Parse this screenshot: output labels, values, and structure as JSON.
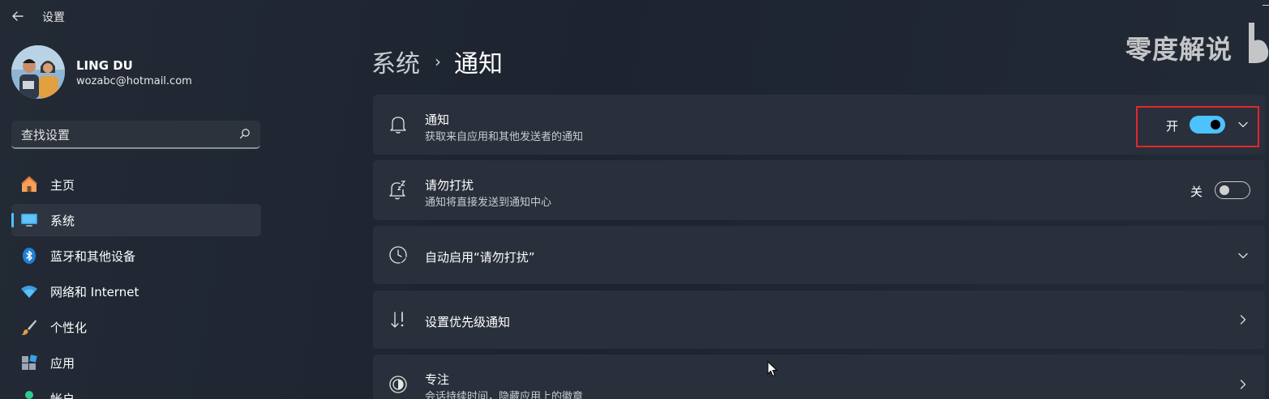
{
  "titlebar": {
    "back_icon": "back-arrow-icon",
    "title": "设置"
  },
  "profile": {
    "name": "LING DU",
    "email": "wozabc@hotmail.com"
  },
  "search": {
    "placeholder": "查找设置",
    "icon": "search-icon"
  },
  "nav": {
    "items": [
      {
        "label": "主页",
        "icon": "home-icon",
        "active": false
      },
      {
        "label": "系统",
        "icon": "system-monitor-icon",
        "active": true
      },
      {
        "label": "蓝牙和其他设备",
        "icon": "bluetooth-icon",
        "active": false
      },
      {
        "label": "网络和 Internet",
        "icon": "wifi-icon",
        "active": false
      },
      {
        "label": "个性化",
        "icon": "paintbrush-icon",
        "active": false
      },
      {
        "label": "应用",
        "icon": "apps-icon",
        "active": false
      },
      {
        "label": "帐户",
        "icon": "account-icon",
        "active": false
      }
    ]
  },
  "header": {
    "breadcrumb_parent": "系统",
    "breadcrumb_sep": "›",
    "breadcrumb_current": "通知"
  },
  "watermark": "零度解说",
  "settings": {
    "notifications": {
      "title": "通知",
      "subtitle": "获取来自应用和其他发送者的通知",
      "state_label": "开",
      "enabled": true,
      "icon": "bell-icon"
    },
    "dnd": {
      "title": "请勿打扰",
      "subtitle": "通知将直接发送到通知中心",
      "state_label": "关",
      "enabled": false,
      "icon": "bell-snooze-icon"
    },
    "auto_dnd": {
      "title": "自动启用“请勿打扰”",
      "icon": "clock-icon"
    },
    "priority": {
      "title": "设置优先级通知",
      "icon": "priority-sort-icon"
    },
    "focus": {
      "title": "专注",
      "subtitle": "会话持续时间，隐藏应用上的徽章",
      "icon": "focus-icon"
    }
  },
  "colors": {
    "accent": "#4cc2ff",
    "background": "#1f2631",
    "card": "#2a303b",
    "highlight_border": "#e0282b"
  }
}
